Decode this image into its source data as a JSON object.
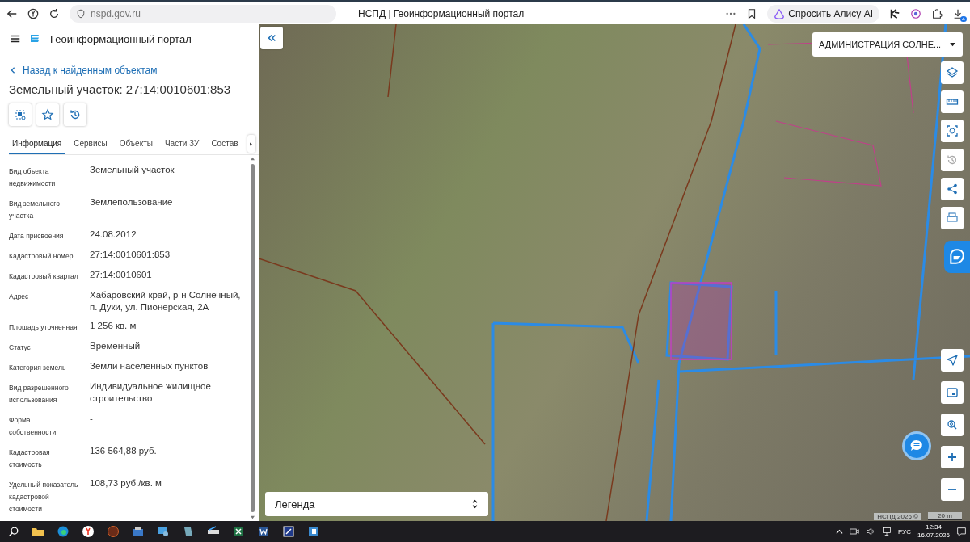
{
  "browser": {
    "url": "nspd.gov.ru",
    "title": "НСПД | Геоинформационный портал",
    "assistant_button": "Спросить Алису AI",
    "downloads_badge": "4"
  },
  "panel": {
    "app_title": "Геоинформационный портал",
    "back_link": "Назад к найденным объектам",
    "heading": "Земельный участок: 27:14:0010601:853",
    "tabs": [
      {
        "label": "Информация",
        "selected": true
      },
      {
        "label": "Сервисы",
        "selected": false
      },
      {
        "label": "Объекты",
        "selected": false
      },
      {
        "label": "Части ЗУ",
        "selected": false
      },
      {
        "label": "Состав",
        "selected": false
      }
    ],
    "properties": [
      {
        "label": "Вид объекта недвижимости",
        "value": "Земельный участок"
      },
      {
        "label": "Вид земельного участка",
        "value": "Землепользование"
      },
      {
        "label": "Дата присвоения",
        "value": "24.08.2012"
      },
      {
        "label": "Кадастровый номер",
        "value": "27:14:0010601:853"
      },
      {
        "label": "Кадастровый квартал",
        "value": "27:14:0010601"
      },
      {
        "label": "Адрес",
        "value": "Хабаровский край, р-н Солнечный, п. Дуки, ул. Пионерская, 2А"
      },
      {
        "label": "Площадь уточненная",
        "value": "1 256 кв. м"
      },
      {
        "label": "Статус",
        "value": "Временный"
      },
      {
        "label": "Категория земель",
        "value": "Земли населенных пунктов"
      },
      {
        "label": "Вид разрешенного использования",
        "value": "Индивидуальное жилищное строительство"
      },
      {
        "label": "Форма собственности",
        "value": "-"
      },
      {
        "label": "Кадастровая стоимость",
        "value": "136 564,88 руб."
      },
      {
        "label": "Удельный показатель кадастровой стоимости",
        "value": "108,73 руб./кв. м"
      }
    ]
  },
  "map": {
    "district_select": "АДМИНИСТРАЦИЯ СОЛНЕ...",
    "legend": "Легенда",
    "attribution": "НСПД 2026 ©",
    "scale": "20 m"
  },
  "taskbar": {
    "language": "РУС",
    "time": "12:34",
    "date": "16.07.2026"
  }
}
